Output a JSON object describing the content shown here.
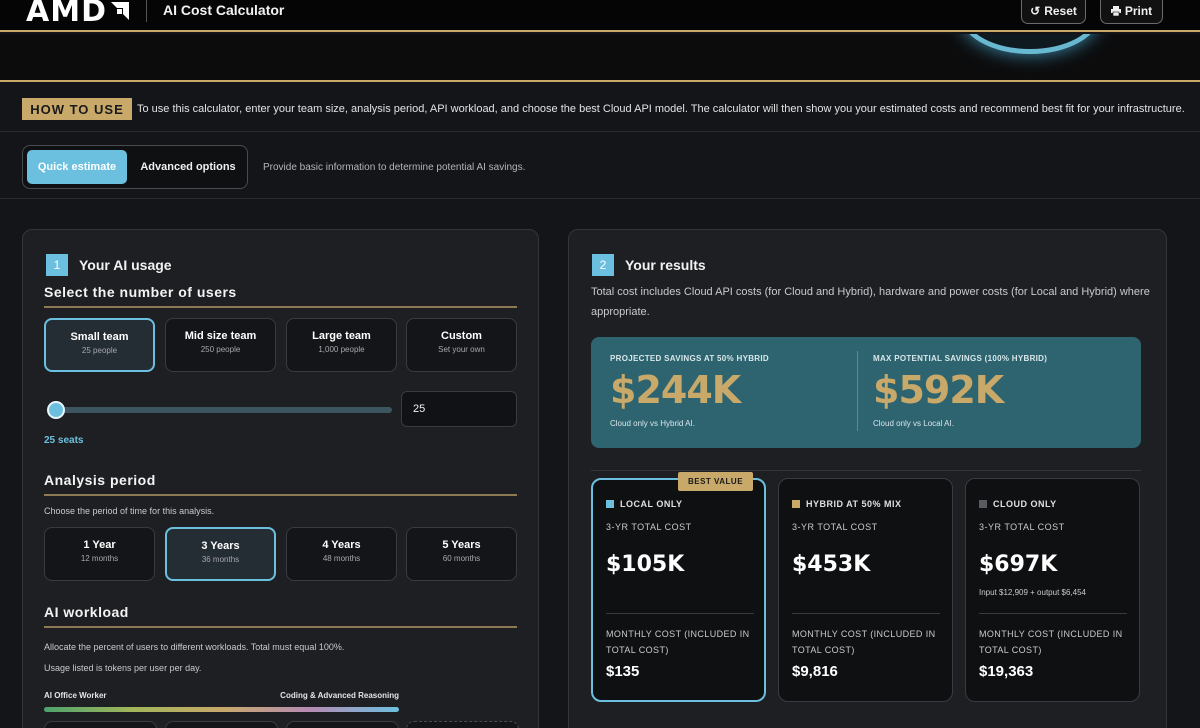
{
  "header": {
    "logo": "AMD",
    "app_title": "AI Cost Calculator",
    "reset_label": "Reset",
    "print_label": "Print"
  },
  "howto": {
    "tag": "HOW TO USE",
    "text": "To use this calculator, enter your team size, analysis period, API workload, and choose the best Cloud API model. The calculator will then show you your estimated costs and recommend best fit for your infrastructure."
  },
  "mode": {
    "quick_label": "Quick estimate",
    "advanced_label": "Advanced options",
    "description": "Provide basic information to determine potential AI savings."
  },
  "usage": {
    "step": "1",
    "title": "Your AI usage",
    "users_title": "Select the number of users",
    "team_options": [
      {
        "title": "Small team",
        "sub": "25 people"
      },
      {
        "title": "Mid size team",
        "sub": "250 people"
      },
      {
        "title": "Large team",
        "sub": "1,000 people"
      },
      {
        "title": "Custom",
        "sub": "Set your own"
      }
    ],
    "seat_value": "25",
    "seats_label": "25 seats",
    "seats_fraction": 0,
    "period_title": "Analysis period",
    "period_desc": "Choose the period of time for this analysis.",
    "period_options": [
      {
        "title": "1 Year",
        "sub": "12 months"
      },
      {
        "title": "3 Years",
        "sub": "36 months"
      },
      {
        "title": "4 Years",
        "sub": "48 months"
      },
      {
        "title": "5 Years",
        "sub": "60 months"
      }
    ],
    "workload_title": "AI workload",
    "workload_desc1": "Allocate the percent of users to different workloads. Total must equal 100%.",
    "workload_desc2": "Usage listed is tokens per user per day.",
    "workload_left": "AI Office Worker",
    "workload_right": "Coding & Advanced Reasoning"
  },
  "results": {
    "step": "2",
    "title": "Your results",
    "description": "Total cost includes Cloud API costs (for Cloud and Hybrid), hardware and power costs (for Local and Hybrid) where appropriate.",
    "savings": [
      {
        "label": "PROJECTED SAVINGS AT 50% HYBRID",
        "value": "$244K",
        "note": "Cloud only vs Hybrid AI."
      },
      {
        "label": "MAX POTENTIAL SAVINGS (100% HYBRID)",
        "value": "$592K",
        "note": "Cloud only vs Local AI."
      }
    ],
    "best_badge": "BEST VALUE",
    "cards": [
      {
        "name": "LOCAL ONLY",
        "color": "#6cc0df",
        "sub": "3-YR TOTAL COST",
        "value": "$105K",
        "input": "",
        "monthly_label": "MONTHLY COST (INCLUDED IN TOTAL COST)",
        "monthly_value": "$135"
      },
      {
        "name": "HYBRID AT 50% MIX",
        "color": "#c8a96a",
        "sub": "3-YR TOTAL COST",
        "value": "$453K",
        "input": "",
        "monthly_label": "MONTHLY COST (INCLUDED IN TOTAL COST)",
        "monthly_value": "$9,816"
      },
      {
        "name": "CLOUD ONLY",
        "color": "#5a5b60",
        "sub": "3-YR TOTAL COST",
        "value": "$697K",
        "input": "Input $12,909 + output $6,454",
        "monthly_label": "MONTHLY COST (INCLUDED IN TOTAL COST)",
        "monthly_value": "$19,363"
      }
    ]
  }
}
